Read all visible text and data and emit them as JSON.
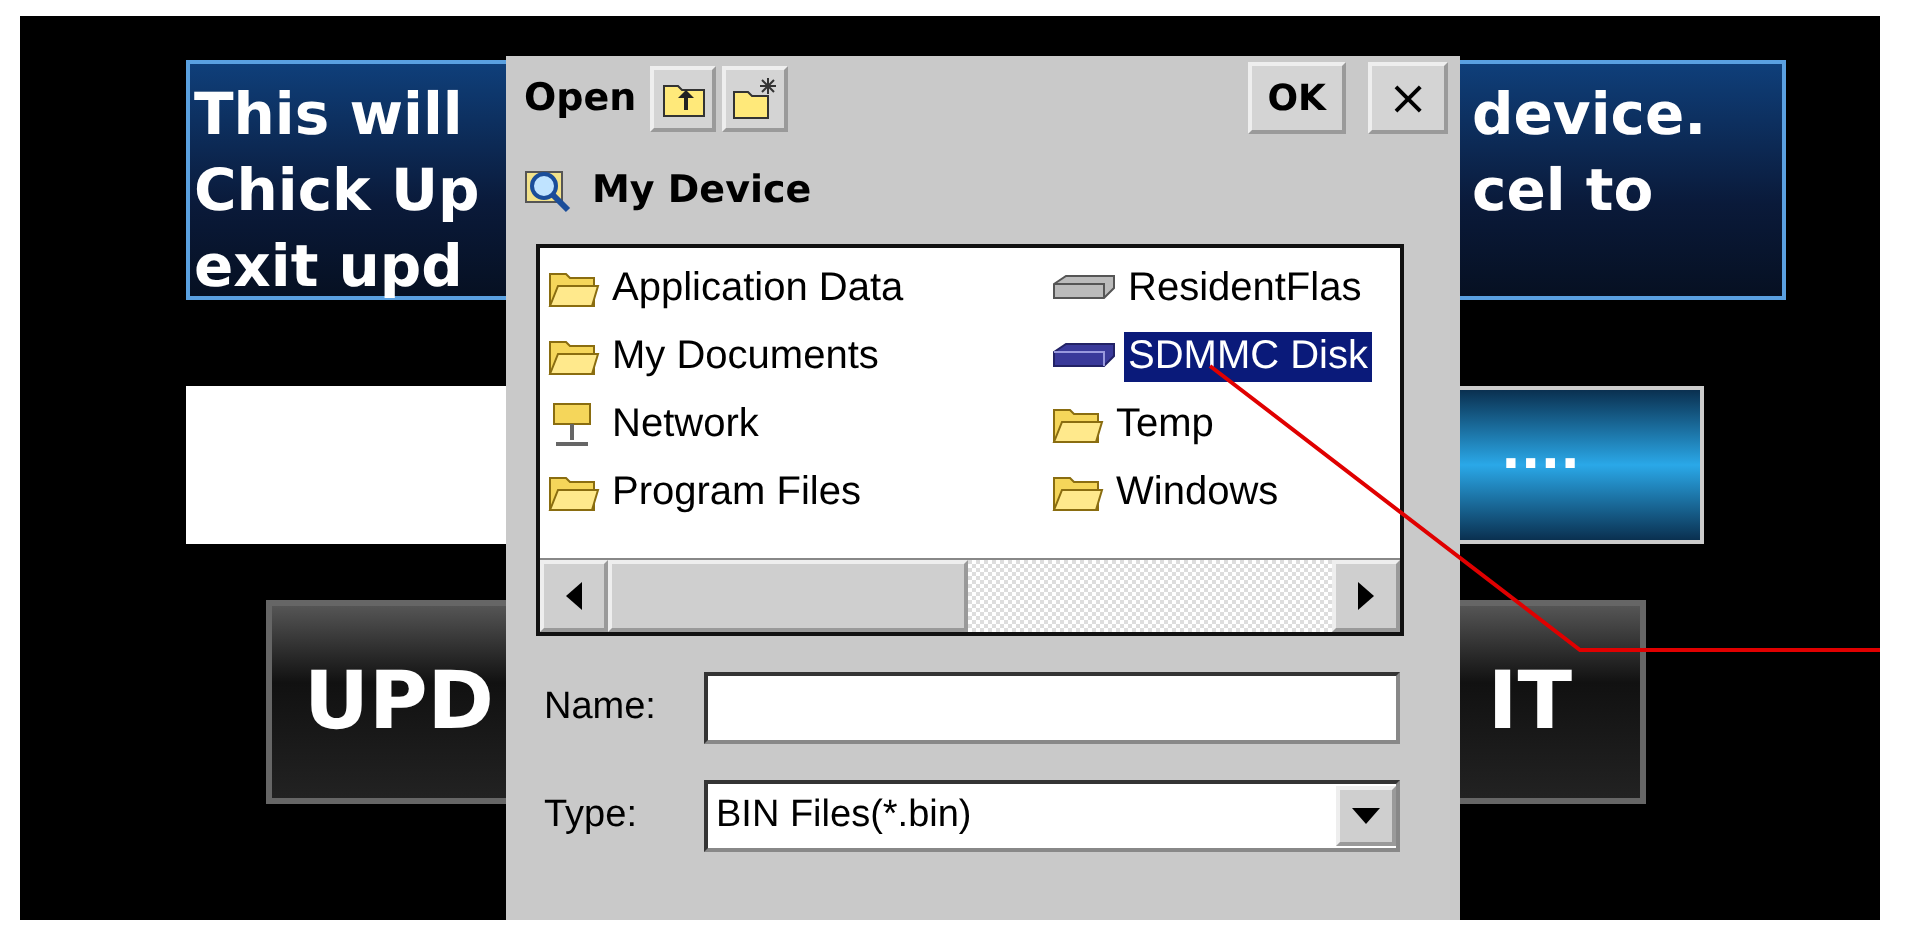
{
  "background": {
    "message_left": [
      "This will",
      "Chick Up",
      "exit upd"
    ],
    "message_right": [
      "device.",
      "cel to"
    ],
    "browse_button": "....",
    "buttons": [
      "UPD",
      "IT"
    ]
  },
  "dialog": {
    "title": "Open",
    "ok": "OK",
    "close": "×",
    "location": "My Device",
    "items": [
      {
        "label": "Application Data",
        "kind": "folder",
        "selected": false
      },
      {
        "label": "My Documents",
        "kind": "folder",
        "selected": false
      },
      {
        "label": "Network",
        "kind": "network",
        "selected": false
      },
      {
        "label": "Program Files",
        "kind": "folder",
        "selected": false
      },
      {
        "label": "ResidentFlas",
        "kind": "drive",
        "selected": false
      },
      {
        "label": "SDMMC Disk",
        "kind": "card",
        "selected": true
      },
      {
        "label": "Temp",
        "kind": "folder",
        "selected": false
      },
      {
        "label": "Windows",
        "kind": "folder",
        "selected": false
      }
    ],
    "name_label": "Name:",
    "type_label": "Type:",
    "type_value": "BIN Files(*.bin)"
  }
}
